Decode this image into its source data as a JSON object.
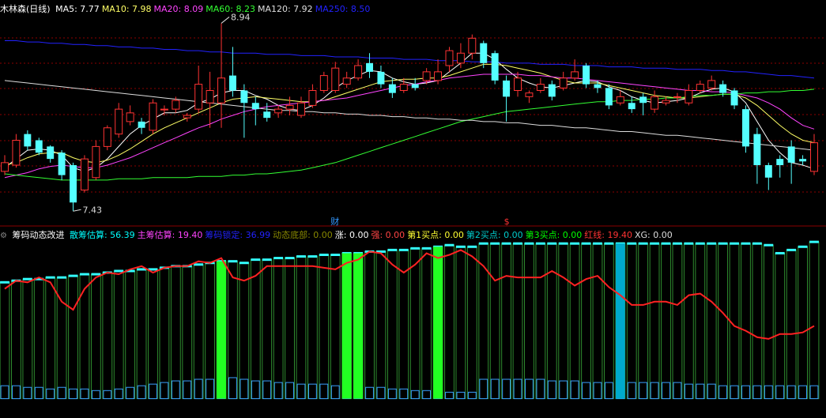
{
  "top_panel": {
    "title": "木林森(日线)",
    "indicators": [
      {
        "label": "MA5: 7.77",
        "color": "#ffffff"
      },
      {
        "label": "MA10: 7.98",
        "color": "#ffff66"
      },
      {
        "label": "MA20: 8.09",
        "color": "#ff44ff"
      },
      {
        "label": "MA60: 8.23",
        "color": "#33ff33"
      },
      {
        "label": "MA120: 7.92",
        "color": "#dddddd"
      },
      {
        "label": "MA250: 8.50",
        "color": "#2222ff"
      }
    ],
    "high_label": "8.94",
    "low_label": "7.43",
    "event_cai": "财",
    "event_s": "$"
  },
  "bottom_panel": {
    "gear_icon": "gear-icon",
    "title": "筹码动态改进",
    "indicators": [
      {
        "label": "散筹估算: 56.39",
        "color": "#00ffff"
      },
      {
        "label": "主筹估算: 19.40",
        "color": "#ff44ff"
      },
      {
        "label": "筹码锁定: 36.99",
        "color": "#2222ff"
      },
      {
        "label": "动态底部: 0.00",
        "color": "#888800"
      },
      {
        "label": "涨: 0.00",
        "color": "#ffffff"
      },
      {
        "label": "强: 0.00",
        "color": "#ff4444"
      },
      {
        "label": "第1买点: 0.00",
        "color": "#ffff33"
      },
      {
        "label": "第2买点: 0.00",
        "color": "#00cccc"
      },
      {
        "label": "第3买点: 0.00",
        "color": "#00ff00"
      },
      {
        "label": "红线: 19.40",
        "color": "#ff3333"
      },
      {
        "label": "XG: 0.00",
        "color": "#dddddd"
      }
    ]
  },
  "colors": {
    "up": "#ff3333",
    "down": "#54ffff",
    "grid": "#8b0000"
  },
  "chart_data": [
    {
      "type": "candlestick",
      "title": "木林森(日线)",
      "ylim": [
        7.4,
        9.0
      ],
      "x": [
        0,
        1,
        2,
        3,
        4,
        5,
        6,
        7,
        8,
        9,
        10,
        11,
        12,
        13,
        14,
        15,
        16,
        17,
        18,
        19,
        20,
        21,
        22,
        23,
        24,
        25,
        26,
        27,
        28,
        29,
        30,
        31,
        32,
        33,
        34,
        35,
        36,
        37,
        38,
        39,
        40,
        41,
        42,
        43,
        44,
        45,
        46,
        47,
        48,
        49,
        50,
        51,
        52,
        53,
        54,
        55,
        56,
        57,
        58,
        59,
        60,
        61,
        62,
        63,
        64,
        65,
        66,
        67,
        68,
        69,
        70,
        71
      ],
      "open": [
        7.75,
        7.8,
        8.05,
        8.0,
        7.95,
        7.9,
        7.8,
        7.6,
        7.7,
        7.95,
        8.05,
        8.15,
        8.15,
        8.08,
        8.25,
        8.25,
        8.18,
        8.25,
        8.3,
        8.3,
        8.52,
        8.4,
        8.3,
        8.23,
        8.22,
        8.25,
        8.2,
        8.28,
        8.4,
        8.4,
        8.45,
        8.5,
        8.62,
        8.55,
        8.45,
        8.4,
        8.45,
        8.48,
        8.48,
        8.6,
        8.62,
        8.7,
        8.78,
        8.7,
        8.48,
        8.4,
        8.35,
        8.4,
        8.45,
        8.42,
        8.5,
        8.6,
        8.45,
        8.42,
        8.3,
        8.3,
        8.35,
        8.25,
        8.3,
        8.35,
        8.3,
        8.4,
        8.42,
        8.45,
        8.4,
        8.25,
        8.05,
        7.8,
        7.85,
        7.95,
        7.85,
        7.75
      ],
      "close": [
        7.82,
        8.0,
        7.95,
        7.9,
        7.85,
        7.72,
        7.5,
        7.85,
        7.95,
        8.1,
        8.25,
        8.22,
        8.1,
        8.3,
        8.25,
        8.32,
        8.2,
        8.45,
        8.4,
        8.5,
        8.4,
        8.3,
        8.25,
        8.18,
        8.25,
        8.28,
        8.3,
        8.4,
        8.52,
        8.58,
        8.5,
        8.6,
        8.55,
        8.45,
        8.38,
        8.45,
        8.42,
        8.55,
        8.55,
        8.72,
        8.7,
        8.82,
        8.62,
        8.48,
        8.35,
        8.5,
        8.38,
        8.45,
        8.35,
        8.5,
        8.55,
        8.45,
        8.42,
        8.28,
        8.35,
        8.25,
        8.3,
        8.35,
        8.32,
        8.35,
        8.4,
        8.45,
        8.48,
        8.38,
        8.28,
        7.95,
        7.8,
        7.7,
        7.8,
        7.82,
        7.83,
        7.98
      ],
      "high": [
        7.88,
        8.05,
        8.08,
        8.02,
        7.96,
        7.92,
        7.82,
        7.88,
        8.0,
        8.12,
        8.3,
        8.28,
        8.18,
        8.33,
        8.28,
        8.35,
        8.22,
        8.6,
        8.55,
        8.94,
        8.75,
        8.45,
        8.35,
        8.3,
        8.28,
        8.35,
        8.35,
        8.45,
        8.55,
        8.63,
        8.55,
        8.65,
        8.7,
        8.6,
        8.5,
        8.5,
        8.5,
        8.58,
        8.65,
        8.75,
        8.78,
        8.85,
        8.8,
        8.72,
        8.52,
        8.55,
        8.4,
        8.5,
        8.48,
        8.55,
        8.65,
        8.62,
        8.48,
        8.45,
        8.4,
        8.35,
        8.38,
        8.4,
        8.35,
        8.38,
        8.45,
        8.48,
        8.52,
        8.48,
        8.42,
        8.28,
        8.1,
        7.82,
        7.88,
        8.0,
        7.88,
        8.05
      ],
      "low": [
        7.72,
        7.78,
        7.92,
        7.88,
        7.82,
        7.68,
        7.43,
        7.58,
        7.68,
        7.92,
        8.02,
        8.12,
        8.05,
        8.05,
        8.2,
        8.22,
        8.15,
        8.22,
        8.1,
        8.1,
        8.35,
        8.02,
        8.12,
        8.15,
        8.18,
        8.2,
        8.18,
        8.26,
        8.38,
        8.38,
        8.42,
        8.48,
        8.5,
        8.42,
        8.34,
        8.38,
        8.4,
        8.45,
        8.45,
        8.55,
        8.58,
        8.65,
        8.58,
        8.45,
        8.15,
        8.35,
        8.3,
        8.38,
        8.32,
        8.4,
        8.48,
        8.42,
        8.38,
        8.25,
        8.28,
        8.22,
        8.2,
        8.22,
        8.28,
        8.3,
        8.28,
        8.38,
        8.4,
        8.35,
        8.25,
        7.9,
        7.65,
        7.6,
        7.7,
        7.65,
        7.8,
        7.72
      ],
      "ma_lines": {
        "MA5": [
          7.78,
          7.85,
          7.92,
          7.93,
          7.92,
          7.88,
          7.78,
          7.75,
          7.78,
          7.85,
          7.95,
          8.05,
          8.12,
          8.17,
          8.22,
          8.22,
          8.24,
          8.3,
          8.33,
          8.38,
          8.4,
          8.4,
          8.36,
          8.33,
          8.28,
          8.25,
          8.24,
          8.28,
          8.34,
          8.42,
          8.48,
          8.52,
          8.56,
          8.55,
          8.5,
          8.47,
          8.45,
          8.46,
          8.48,
          8.55,
          8.62,
          8.7,
          8.7,
          8.65,
          8.57,
          8.5,
          8.46,
          8.43,
          8.42,
          8.44,
          8.46,
          8.48,
          8.47,
          8.43,
          8.4,
          8.35,
          8.32,
          8.3,
          8.31,
          8.32,
          8.34,
          8.38,
          8.41,
          8.42,
          8.39,
          8.3,
          8.15,
          8.0,
          7.9,
          7.82,
          7.8,
          7.77
        ],
        "MA10": [
          7.8,
          7.82,
          7.86,
          7.89,
          7.9,
          7.9,
          7.86,
          7.83,
          7.82,
          7.84,
          7.88,
          7.93,
          7.99,
          8.05,
          8.1,
          8.14,
          8.18,
          8.22,
          8.26,
          8.3,
          8.33,
          8.34,
          8.35,
          8.34,
          8.33,
          8.32,
          8.31,
          8.31,
          8.32,
          8.35,
          8.38,
          8.41,
          8.44,
          8.47,
          8.48,
          8.49,
          8.49,
          8.5,
          8.5,
          8.52,
          8.55,
          8.58,
          8.61,
          8.61,
          8.6,
          8.58,
          8.56,
          8.54,
          8.51,
          8.48,
          8.46,
          8.46,
          8.46,
          8.44,
          8.42,
          8.4,
          8.38,
          8.36,
          8.35,
          8.34,
          8.34,
          8.35,
          8.36,
          8.37,
          8.37,
          8.34,
          8.28,
          8.2,
          8.12,
          8.05,
          8.0,
          7.98
        ],
        "MA20": [
          7.7,
          7.72,
          7.74,
          7.77,
          7.79,
          7.8,
          7.79,
          7.78,
          7.78,
          7.8,
          7.83,
          7.86,
          7.9,
          7.94,
          7.98,
          8.02,
          8.06,
          8.1,
          8.13,
          8.17,
          8.2,
          8.23,
          8.25,
          8.27,
          8.28,
          8.29,
          8.3,
          8.31,
          8.32,
          8.33,
          8.34,
          8.36,
          8.38,
          8.4,
          8.42,
          8.44,
          8.45,
          8.47,
          8.48,
          8.5,
          8.51,
          8.52,
          8.53,
          8.53,
          8.53,
          8.53,
          8.52,
          8.52,
          8.51,
          8.5,
          8.5,
          8.49,
          8.48,
          8.47,
          8.46,
          8.45,
          8.44,
          8.43,
          8.42,
          8.41,
          8.4,
          8.4,
          8.39,
          8.39,
          8.38,
          8.36,
          8.34,
          8.3,
          8.25,
          8.18,
          8.12,
          8.09
        ],
        "MA60": [
          7.73,
          7.72,
          7.71,
          7.7,
          7.69,
          7.68,
          7.68,
          7.68,
          7.68,
          7.68,
          7.69,
          7.69,
          7.69,
          7.7,
          7.7,
          7.7,
          7.7,
          7.71,
          7.71,
          7.71,
          7.72,
          7.72,
          7.73,
          7.73,
          7.74,
          7.75,
          7.76,
          7.78,
          7.8,
          7.82,
          7.85,
          7.88,
          7.91,
          7.94,
          7.97,
          8.0,
          8.03,
          8.06,
          8.09,
          8.12,
          8.15,
          8.17,
          8.19,
          8.21,
          8.23,
          8.24,
          8.25,
          8.26,
          8.27,
          8.28,
          8.29,
          8.3,
          8.31,
          8.31,
          8.32,
          8.32,
          8.33,
          8.33,
          8.34,
          8.34,
          8.35,
          8.36,
          8.36,
          8.37,
          8.37,
          8.38,
          8.38,
          8.39,
          8.39,
          8.4,
          8.4,
          8.41
        ],
        "MA120": [
          8.48,
          8.47,
          8.46,
          8.45,
          8.44,
          8.43,
          8.42,
          8.41,
          8.4,
          8.39,
          8.38,
          8.37,
          8.36,
          8.35,
          8.34,
          8.33,
          8.32,
          8.31,
          8.3,
          8.29,
          8.28,
          8.27,
          8.26,
          8.25,
          8.24,
          8.24,
          8.23,
          8.23,
          8.22,
          8.22,
          8.21,
          8.21,
          8.2,
          8.2,
          8.19,
          8.19,
          8.18,
          8.18,
          8.17,
          8.17,
          8.16,
          8.16,
          8.15,
          8.15,
          8.14,
          8.14,
          8.13,
          8.12,
          8.12,
          8.11,
          8.1,
          8.1,
          8.09,
          8.08,
          8.07,
          8.07,
          8.06,
          8.05,
          8.04,
          8.04,
          8.03,
          8.02,
          8.01,
          8.0,
          7.99,
          7.98,
          7.97,
          7.96,
          7.95,
          7.94,
          7.93,
          7.92
        ],
        "MA250": [
          8.8,
          8.8,
          8.79,
          8.79,
          8.78,
          8.78,
          8.77,
          8.77,
          8.76,
          8.76,
          8.75,
          8.75,
          8.74,
          8.74,
          8.73,
          8.73,
          8.72,
          8.72,
          8.71,
          8.71,
          8.7,
          8.7,
          8.7,
          8.69,
          8.69,
          8.69,
          8.68,
          8.68,
          8.68,
          8.67,
          8.67,
          8.67,
          8.66,
          8.66,
          8.66,
          8.65,
          8.65,
          8.65,
          8.64,
          8.64,
          8.64,
          8.63,
          8.63,
          8.63,
          8.62,
          8.62,
          8.62,
          8.61,
          8.61,
          8.61,
          8.6,
          8.6,
          8.6,
          8.59,
          8.59,
          8.59,
          8.58,
          8.58,
          8.58,
          8.57,
          8.57,
          8.57,
          8.56,
          8.56,
          8.55,
          8.55,
          8.54,
          8.53,
          8.52,
          8.52,
          8.51,
          8.5
        ]
      }
    },
    {
      "type": "bar",
      "title": "筹码动态改进",
      "ylim": [
        -10,
        100
      ],
      "x": [
        0,
        1,
        2,
        3,
        4,
        5,
        6,
        7,
        8,
        9,
        10,
        11,
        12,
        13,
        14,
        15,
        16,
        17,
        18,
        19,
        20,
        21,
        22,
        23,
        24,
        25,
        26,
        27,
        28,
        29,
        30,
        31,
        32,
        33,
        34,
        35,
        36,
        37,
        38,
        39,
        40,
        41,
        42,
        43,
        44,
        45,
        46,
        47,
        48,
        49,
        50,
        51,
        52,
        53,
        54,
        55,
        56,
        57,
        58,
        59,
        60,
        61,
        62,
        63,
        64,
        65,
        66,
        67,
        68,
        69,
        70,
        71
      ],
      "series": [
        {
          "name": "散筹估算",
          "values": [
            72,
            73,
            74,
            74,
            75,
            75,
            76,
            77,
            77,
            78,
            79,
            79,
            80,
            80,
            81,
            82,
            82,
            83,
            84,
            85,
            85,
            84,
            86,
            86,
            87,
            87,
            88,
            88,
            89,
            89,
            90,
            90,
            91,
            91,
            92,
            92,
            93,
            93,
            94,
            95,
            94,
            94,
            96,
            96,
            96,
            96,
            96,
            96,
            96,
            96,
            96,
            96,
            96,
            96,
            96,
            96,
            96,
            96,
            96,
            96,
            96,
            96,
            96,
            96,
            96,
            96,
            96,
            95,
            90,
            92,
            94,
            97
          ]
        },
        {
          "name": "主筹估算",
          "values": [
            8,
            8,
            7,
            7,
            6,
            7,
            6,
            6,
            5,
            5,
            6,
            7,
            8,
            9,
            10,
            11,
            11,
            12,
            12,
            13,
            13,
            12,
            11,
            11,
            10,
            10,
            9,
            9,
            9,
            8,
            8,
            8,
            7,
            7,
            6,
            6,
            5,
            5,
            5,
            4,
            4,
            4,
            12,
            12,
            12,
            12,
            12,
            12,
            11,
            11,
            11,
            10,
            10,
            10,
            10,
            10,
            10,
            10,
            10,
            10,
            9,
            9,
            9,
            8,
            8,
            8,
            8,
            8,
            8,
            8,
            8,
            8
          ]
        },
        {
          "name": "红线",
          "values": [
            68,
            73,
            72,
            75,
            72,
            60,
            55,
            68,
            75,
            78,
            77,
            80,
            82,
            78,
            81,
            82,
            82,
            85,
            84,
            87,
            75,
            73,
            76,
            82,
            82,
            82,
            82,
            82,
            81,
            80,
            84,
            86,
            91,
            90,
            83,
            78,
            83,
            90,
            87,
            89,
            92,
            88,
            82,
            73,
            76,
            75,
            75,
            75,
            79,
            75,
            70,
            74,
            76,
            69,
            64,
            58,
            58,
            60,
            60,
            58,
            64,
            65,
            60,
            53,
            45,
            42,
            38,
            37,
            40,
            40,
            41,
            45
          ]
        }
      ],
      "highlight_green_at": [
        19,
        30,
        31,
        38
      ],
      "highlight_teal_at": [
        54
      ]
    }
  ]
}
